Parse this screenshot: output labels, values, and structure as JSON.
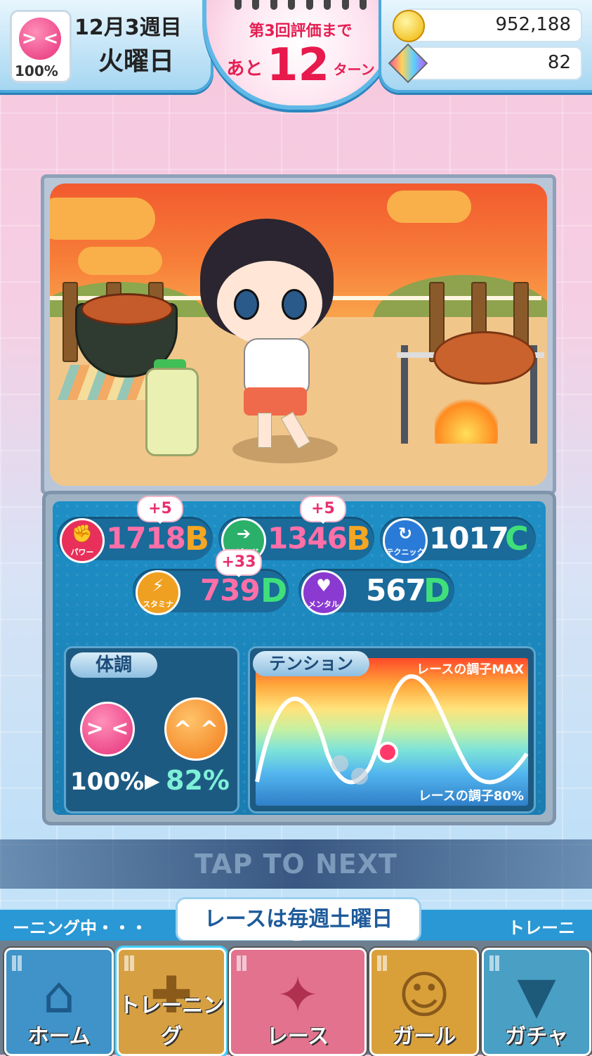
{
  "hud": {
    "mood_face": "> <",
    "mood_percent": "100%",
    "date": "12月3週目",
    "weekday": "火曜日",
    "eval_line1": "第3回評価まで",
    "eval_prefix": "あと",
    "eval_turns": "12",
    "eval_suffix": "ターン",
    "coins": "952,188",
    "gems": "82"
  },
  "stats": {
    "power": {
      "label": "パワー",
      "value": "1718",
      "grade": "B",
      "bonus": "+5"
    },
    "speed": {
      "label": "スピード",
      "value": "1346",
      "grade": "B",
      "bonus": "+5"
    },
    "technique": {
      "label": "テクニック",
      "value": "1017",
      "grade": "C"
    },
    "stamina": {
      "label": "スタミナ",
      "value": "739",
      "grade": "D",
      "bonus": "+33"
    },
    "mental": {
      "label": "メンタル",
      "value": "567",
      "grade": "D"
    }
  },
  "condition": {
    "title": "体調",
    "from": "100%",
    "arrow": "▶",
    "to": "82%",
    "face_from": "> <",
    "face_to": "^ ^"
  },
  "tension": {
    "title": "テンション",
    "max_label": "レースの調子MAX",
    "current_label": "レースの調子80%",
    "current_percent": 80
  },
  "tap_to_next": "TAP TO NEXT",
  "ticker": {
    "left": "ーニング中・・・",
    "right": "トレーニ",
    "bubble": "レースは毎週土曜日"
  },
  "nav": [
    {
      "label": "ホーム",
      "icon": "home-icon",
      "glyph": "⌂",
      "color": "#3f93c8"
    },
    {
      "label": "トレーニング",
      "icon": "dumbbell-icon",
      "glyph": "✚",
      "color": "#d6a042"
    },
    {
      "label": "レース",
      "icon": "runner-icon",
      "glyph": "✦",
      "color": "#e2728e"
    },
    {
      "label": "ガール",
      "icon": "girl-icon",
      "glyph": "☺",
      "color": "#d9a03a"
    },
    {
      "label": "ガチャ",
      "icon": "shirt-icon",
      "glyph": "▼",
      "color": "#4a9fc4"
    }
  ],
  "colors": {
    "grade_b": "#f5a623",
    "grade_c": "#3fe07a",
    "grade_d": "#3fe07a",
    "pink_value": "#ff6fa8",
    "white_value": "#ffffff"
  }
}
